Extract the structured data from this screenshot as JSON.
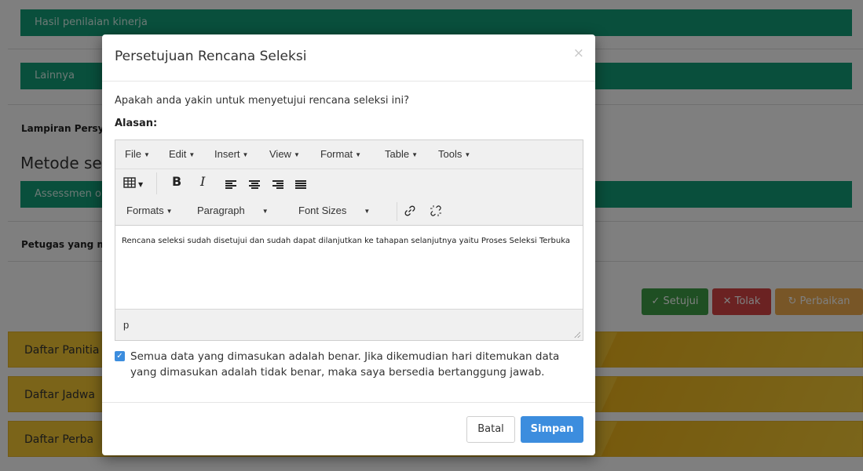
{
  "background": {
    "bars": [
      "Hasil penilaian kinerja",
      "Lainnya",
      "Assessmen o"
    ],
    "labels": {
      "lampiran": "Lampiran Persy",
      "petugas": "Petugas yang m"
    },
    "section_title": "Metode sele",
    "actions": {
      "approve": "✓ Setujui",
      "reject": "✕ Tolak",
      "fix": "↻ Perbaikan"
    },
    "lists": [
      "Daftar Panitia",
      "Daftar Jadwa",
      "Daftar Perba"
    ],
    "colors": {
      "green": "#129e78",
      "approve": "#3e9e46",
      "reject": "#d64545",
      "fix": "#f0ad4e",
      "yellow": "#f5c830"
    }
  },
  "modal": {
    "title": "Persetujuan Rencana Seleksi",
    "close_symbol": "×",
    "question": "Apakah anda yakin untuk menyetujui rencana seleksi ini?",
    "reason_label": "Alasan:",
    "editor": {
      "menu": [
        "File",
        "Edit",
        "Insert",
        "View",
        "Format",
        "Table",
        "Tools"
      ],
      "toolbar": {
        "table_icon": "table-icon",
        "bold": "B",
        "italic": "I",
        "formats": "Formats",
        "paragraph": "Paragraph",
        "font_sizes": "Font Sizes"
      },
      "content": "Rencana seleksi sudah disetujui dan sudah dapat dilanjutkan ke tahapan selanjutnya yaitu Proses Seleksi Terbuka",
      "path": "p"
    },
    "agree": {
      "checked": true,
      "text": "Semua data yang dimasukan adalah benar. Jika dikemudian hari ditemukan data yang dimasukan adalah tidak benar, maka saya bersedia bertanggung jawab."
    },
    "buttons": {
      "cancel": "Batal",
      "save": "Simpan"
    },
    "colors": {
      "primary": "#3c8dde"
    }
  }
}
